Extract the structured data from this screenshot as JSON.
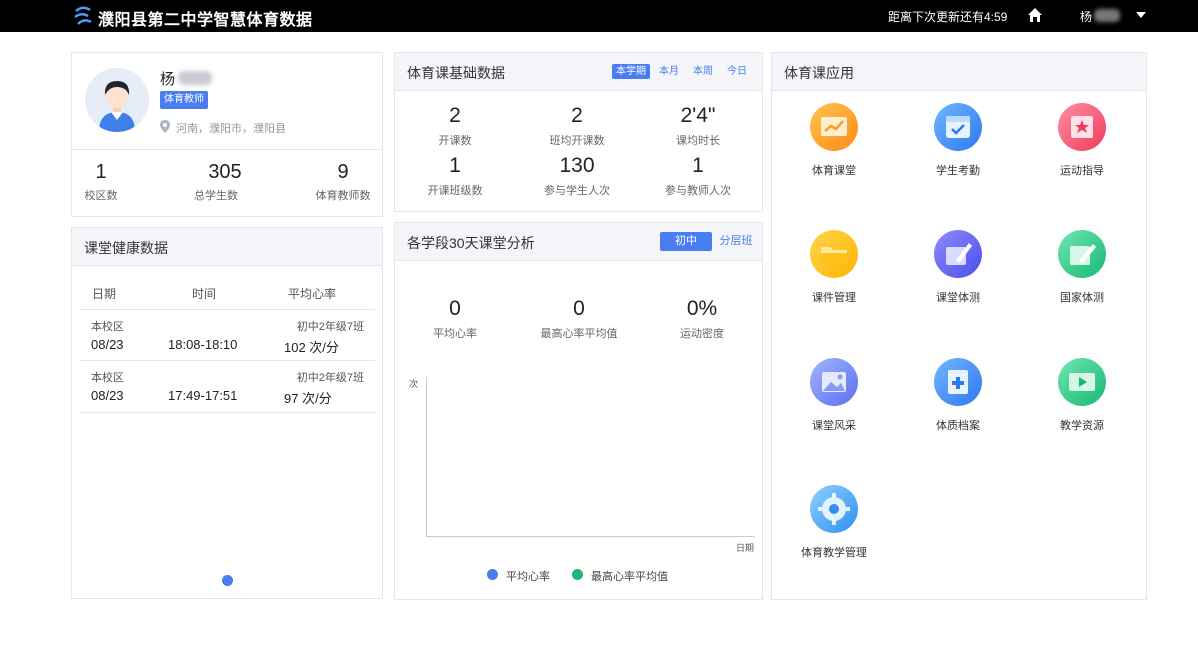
{
  "topbar": {
    "title": "濮阳县第二中学智慧体育数据",
    "countdown": "距离下次更新还有4:59",
    "user": "杨"
  },
  "profile": {
    "name": "杨",
    "role": "体育教师",
    "location": "河南，濮阳市，濮阳县",
    "stats": [
      {
        "value": "1",
        "label": "校区数"
      },
      {
        "value": "305",
        "label": "总学生数"
      },
      {
        "value": "9",
        "label": "体育教师数"
      }
    ]
  },
  "health": {
    "title": "课堂健康数据",
    "headers": [
      "日期",
      "时间",
      "平均心率"
    ],
    "rows": [
      {
        "campus": "本校区",
        "class": "初中2年级7班",
        "date": "08/23",
        "time": "18:08-18:10",
        "hr": "102 次/分"
      },
      {
        "campus": "本校区",
        "class": "初中2年级7班",
        "date": "08/23",
        "time": "17:49-17:51",
        "hr": "97 次/分"
      }
    ]
  },
  "basic": {
    "title": "体育课基础数据",
    "tabs": [
      "本学期",
      "本月",
      "本周",
      "今日"
    ],
    "metrics": [
      {
        "value": "2",
        "label": "开课数"
      },
      {
        "value": "2",
        "label": "班均开课数"
      },
      {
        "value": "2'4\"",
        "label": "课均时长"
      },
      {
        "value": "1",
        "label": "开课班级数"
      },
      {
        "value": "130",
        "label": "参与学生人次"
      },
      {
        "value": "1",
        "label": "参与教师人次"
      }
    ]
  },
  "analysis": {
    "title": "各学段30天课堂分析",
    "seg_active": "初中",
    "seg_other": "分层班",
    "metrics": [
      {
        "value": "0",
        "label": "平均心率"
      },
      {
        "value": "0",
        "label": "最高心率平均值"
      },
      {
        "value": "0%",
        "label": "运动密度"
      }
    ],
    "y_unit": "次",
    "x_title": "日期",
    "legend": [
      {
        "label": "平均心率",
        "color": "#4b7df2"
      },
      {
        "label": "最高心率平均值",
        "color": "#22b573"
      }
    ]
  },
  "apps": {
    "title": "体育课应用",
    "items": [
      {
        "label": "体育课堂",
        "icon": "chart-screen-icon"
      },
      {
        "label": "学生考勤",
        "icon": "calendar-check-icon"
      },
      {
        "label": "运动指导",
        "icon": "star-flag-icon"
      },
      {
        "label": "课件管理",
        "icon": "folder-icon"
      },
      {
        "label": "课堂体测",
        "icon": "pencil-ruler-icon"
      },
      {
        "label": "国家体测",
        "icon": "pen-paper-icon"
      },
      {
        "label": "课堂风采",
        "icon": "picture-icon"
      },
      {
        "label": "体质档案",
        "icon": "health-file-icon"
      },
      {
        "label": "教学资源",
        "icon": "video-player-icon"
      },
      {
        "label": "体育教学管理",
        "icon": "gear-icon"
      }
    ]
  },
  "colors": {
    "accent": "#4b7df2",
    "green": "#22b573",
    "topbar": "#000000"
  }
}
